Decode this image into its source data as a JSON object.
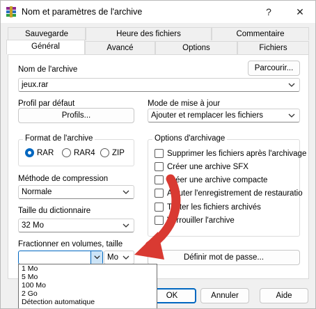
{
  "window": {
    "title": "Nom et paramètres de l'archive",
    "help_glyph": "?",
    "close_glyph": "✕"
  },
  "tabs": {
    "row_top": [
      {
        "label": "Sauvegarde"
      },
      {
        "label": "Heure des fichiers"
      },
      {
        "label": "Commentaire"
      }
    ],
    "row_bottom": [
      {
        "label": "Général",
        "active": true
      },
      {
        "label": "Avancé"
      },
      {
        "label": "Options"
      },
      {
        "label": "Fichiers"
      }
    ]
  },
  "general": {
    "archive_name_label": "Nom de l'archive",
    "browse_button": "Parcourir...",
    "archive_name_value": "jeux.rar",
    "default_profile_label": "Profil par défaut",
    "profiles_button": "Profils...",
    "update_mode_label": "Mode de mise à jour",
    "update_mode_value": "Ajouter et remplacer les fichiers",
    "format_group_title": "Format de l'archive",
    "formats": [
      {
        "label": "RAR",
        "selected": true
      },
      {
        "label": "RAR4",
        "selected": false
      },
      {
        "label": "ZIP",
        "selected": false
      }
    ],
    "options_group_title": "Options d'archivage",
    "options": [
      {
        "label": "Supprimer les fichiers après l'archivage",
        "checked": false
      },
      {
        "label": "Créer une archive SFX",
        "checked": false
      },
      {
        "label": "Créer une archive compacte",
        "checked": false
      },
      {
        "label": "Ajouter l'enregistrement de restauratio",
        "checked": false
      },
      {
        "label": "Tester les fichiers archivés",
        "checked": false
      },
      {
        "label": "Verrouiller l'archive",
        "checked": false
      }
    ],
    "compression_label": "Méthode de compression",
    "compression_value": "Normale",
    "dictionary_label": "Taille du dictionnaire",
    "dictionary_value": "32 Mo",
    "split_label": "Fractionner en volumes, taille",
    "split_value": "",
    "split_unit": "Mo",
    "set_password_button": "Définir mot de passe...",
    "split_options": [
      "1 Mo",
      "5 Mo",
      "100 Mo",
      "2 Go",
      "Détection automatique"
    ]
  },
  "footer": {
    "ok_button": "OK",
    "cancel_button": "Annuler",
    "help_button": "Aide"
  },
  "colors": {
    "accent": "#0067c0",
    "arrow": "#d93a32"
  }
}
